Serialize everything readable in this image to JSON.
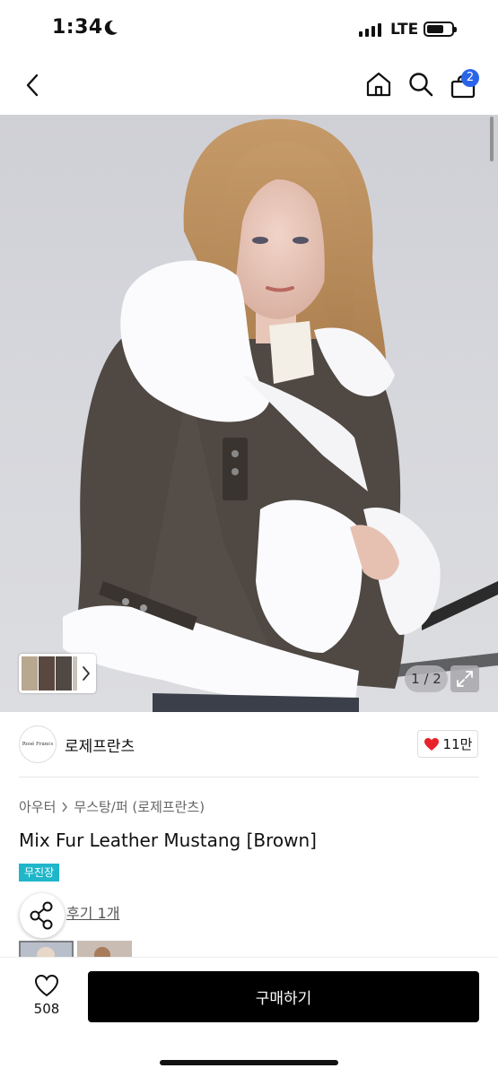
{
  "status_bar": {
    "time": "1:34",
    "network": "LTE"
  },
  "nav": {
    "cart_count": "2"
  },
  "gallery": {
    "page_indicator": "1 / 2"
  },
  "shop": {
    "logo_text": "Rosé Francs",
    "name": "로제프란츠",
    "likes": "11만"
  },
  "breadcrumb": {
    "level1": "아우터",
    "level2": "무스탕/퍼 (로제프란츠)"
  },
  "product": {
    "title": "Mix Fur Leather Mustang [Brown]",
    "tag": "무진장",
    "review_link": "후기 1개"
  },
  "bottom_bar": {
    "wish_count": "508",
    "buy_label": "구매하기"
  },
  "colors": {
    "accent_blue": "#2a64e8",
    "tag_teal": "#1fb6c9",
    "like_red": "#e8232b",
    "buy_black": "#000000"
  },
  "icons": [
    "back-icon",
    "home-icon",
    "search-icon",
    "cart-icon",
    "chevron-right-icon",
    "expand-icon",
    "heart-icon",
    "share-icon"
  ]
}
